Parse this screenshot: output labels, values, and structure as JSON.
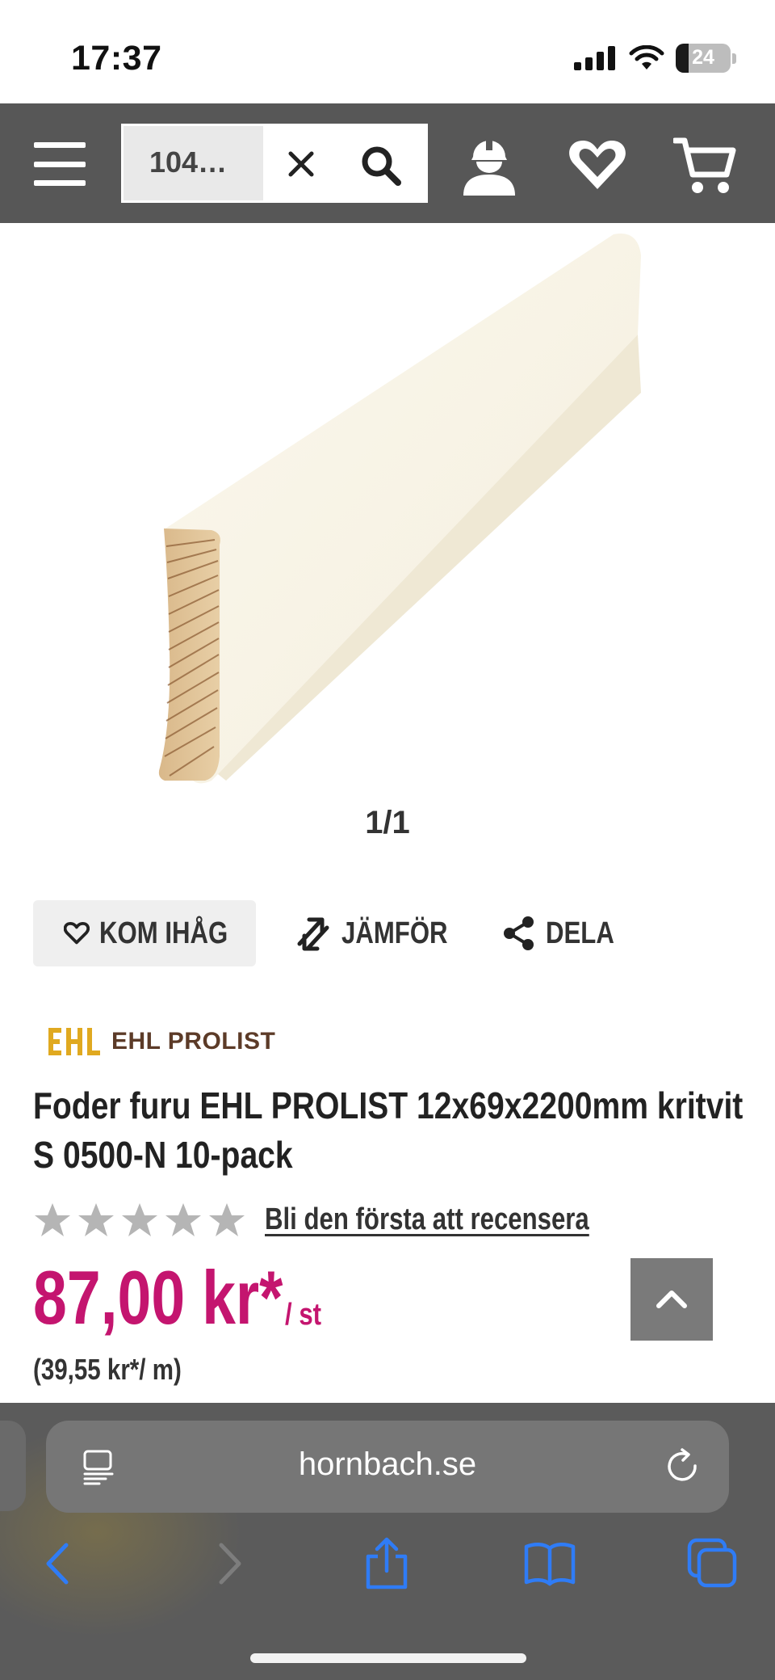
{
  "status_bar": {
    "time": "17:37",
    "battery_level": "24",
    "battery_fraction": 0.24,
    "icons": [
      "cellular-signal-icon",
      "wifi-icon",
      "battery-icon"
    ]
  },
  "header": {
    "search_query": "104…",
    "icons": [
      "menu-icon",
      "close-icon",
      "search-icon",
      "account-icon",
      "heart-icon",
      "cart-icon"
    ]
  },
  "gallery": {
    "counter": "1/1"
  },
  "actions": {
    "remember_label": "KOM IHÅG",
    "compare_label": "JÄMFÖR",
    "share_label": "DELA"
  },
  "product": {
    "brand": "EHL PROLIST",
    "brand_logo_text": "EHL",
    "title": "Foder furu EHL PROLIST 12x69x2200mm kritvit S 0500-N 10-pack",
    "rating_stars": 0,
    "rating_max": 5,
    "review_link": "Bli den första att recensera",
    "price": "87,00 kr*",
    "price_unit": "/ st",
    "unit_price": "(39,55 kr*/ m)"
  },
  "browser": {
    "url": "hornbach.se",
    "icons": [
      "reader-icon",
      "reload-icon",
      "back-icon",
      "forward-icon",
      "share-icon",
      "bookmarks-icon",
      "tabs-icon"
    ]
  },
  "colors": {
    "header_bg": "#575757",
    "price": "#c4156f",
    "brand_gold": "#e0a920",
    "brand_brown": "#5c3b28",
    "ios_blue": "#2f7cf6",
    "browser_bg": "#5b5b5b"
  }
}
